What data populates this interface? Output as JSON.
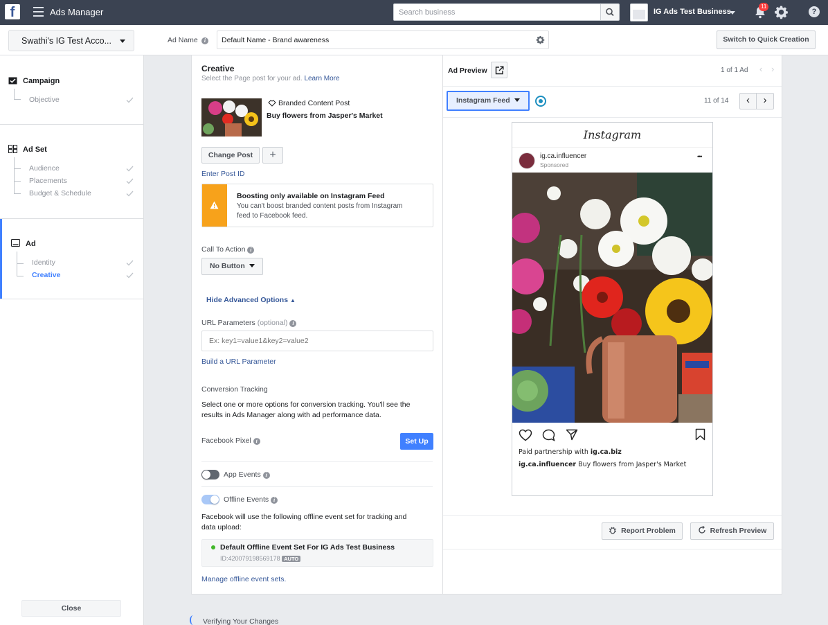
{
  "topbar": {
    "app_title": "Ads Manager",
    "search_placeholder": "Search business",
    "business_name": "IG Ads Test Business",
    "notification_count": "11"
  },
  "subheader": {
    "account_name": "Swathi's IG Test Acco...",
    "ad_name_label": "Ad Name",
    "ad_name_value": "Default Name - Brand awareness",
    "quick_creation_label": "Switch to Quick Creation"
  },
  "nav": {
    "campaign": {
      "label": "Campaign",
      "items": [
        "Objective"
      ]
    },
    "adset": {
      "label": "Ad Set",
      "items": [
        "Audience",
        "Placements",
        "Budget & Schedule"
      ]
    },
    "ad": {
      "label": "Ad",
      "items": [
        "Identity",
        "Creative"
      ]
    },
    "close_label": "Close"
  },
  "creative": {
    "title": "Creative",
    "subtitle": "Select the Page post for your ad.",
    "learn_more": "Learn More",
    "post_type": "Branded Content Post",
    "post_text": "Buy flowers from Jasper's Market",
    "change_post_label": "Change Post",
    "add_label": "+",
    "enter_post_id": "Enter Post ID",
    "warning_title": "Boosting only available on Instagram Feed",
    "warning_body_1": "You can't boost branded content posts from Instagram",
    "warning_body_2": "feed to Facebook feed.",
    "cta_label": "Call To Action",
    "cta_value": "No Button",
    "hide_advanced": "Hide Advanced Options",
    "url_params_label": "URL Parameters",
    "url_params_optional": "(optional)",
    "url_params_placeholder": "Ex: key1=value1&key2=value2",
    "build_url": "Build a URL Parameter",
    "conversion_title": "Conversion Tracking",
    "conversion_desc_1": "Select one or more options for conversion tracking. You'll see the",
    "conversion_desc_2": "results in Ads Manager along with ad performance data.",
    "pixel_label": "Facebook Pixel",
    "setup_label": "Set Up",
    "app_events_label": "App Events",
    "offline_events_label": "Offline Events",
    "offline_desc_1": "Facebook will use the following offline event set for tracking and",
    "offline_desc_2": "data upload:",
    "offline_set_name": "Default Offline Event Set For IG Ads Test Business",
    "offline_set_id": "ID:420079198569178",
    "offline_set_badge": "AUTO",
    "manage_sets": "Manage offline event sets."
  },
  "preview": {
    "title": "Ad Preview",
    "ad_count": "1 of 1 Ad",
    "placement": "Instagram Feed",
    "placement_count": "11 of 14",
    "ig_logo": "Instagram",
    "ig_username": "ig.ca.influencer",
    "ig_sponsored": "Sponsored",
    "ig_more": "•••",
    "ig_partnership_prefix": "Paid partnership with",
    "ig_partner": "ig.ca.biz",
    "ig_caption_user": "ig.ca.influencer",
    "ig_caption_text": "Buy flowers from Jasper's Market",
    "report_label": "Report Problem",
    "refresh_label": "Refresh Preview"
  },
  "footer": {
    "verifying": "Verifying Your Changes"
  },
  "colors": {
    "topbar": "#3b4352",
    "accent_blue": "#4080ff",
    "link": "#365899",
    "warning": "#f7a21b",
    "success": "#42b72a"
  }
}
